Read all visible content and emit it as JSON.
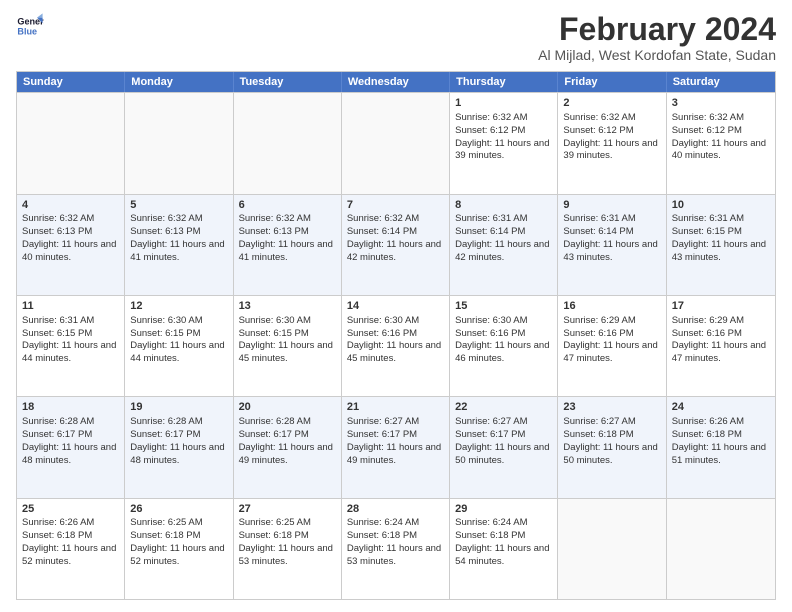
{
  "logo": {
    "line1": "General",
    "line2": "Blue"
  },
  "title": "February 2024",
  "location": "Al Mijlad, West Kordofan State, Sudan",
  "days_of_week": [
    "Sunday",
    "Monday",
    "Tuesday",
    "Wednesday",
    "Thursday",
    "Friday",
    "Saturday"
  ],
  "weeks": [
    [
      {
        "day": "",
        "sunrise": "",
        "sunset": "",
        "daylight": ""
      },
      {
        "day": "",
        "sunrise": "",
        "sunset": "",
        "daylight": ""
      },
      {
        "day": "",
        "sunrise": "",
        "sunset": "",
        "daylight": ""
      },
      {
        "day": "",
        "sunrise": "",
        "sunset": "",
        "daylight": ""
      },
      {
        "day": "1",
        "sunrise": "Sunrise: 6:32 AM",
        "sunset": "Sunset: 6:12 PM",
        "daylight": "Daylight: 11 hours and 39 minutes."
      },
      {
        "day": "2",
        "sunrise": "Sunrise: 6:32 AM",
        "sunset": "Sunset: 6:12 PM",
        "daylight": "Daylight: 11 hours and 39 minutes."
      },
      {
        "day": "3",
        "sunrise": "Sunrise: 6:32 AM",
        "sunset": "Sunset: 6:12 PM",
        "daylight": "Daylight: 11 hours and 40 minutes."
      }
    ],
    [
      {
        "day": "4",
        "sunrise": "Sunrise: 6:32 AM",
        "sunset": "Sunset: 6:13 PM",
        "daylight": "Daylight: 11 hours and 40 minutes."
      },
      {
        "day": "5",
        "sunrise": "Sunrise: 6:32 AM",
        "sunset": "Sunset: 6:13 PM",
        "daylight": "Daylight: 11 hours and 41 minutes."
      },
      {
        "day": "6",
        "sunrise": "Sunrise: 6:32 AM",
        "sunset": "Sunset: 6:13 PM",
        "daylight": "Daylight: 11 hours and 41 minutes."
      },
      {
        "day": "7",
        "sunrise": "Sunrise: 6:32 AM",
        "sunset": "Sunset: 6:14 PM",
        "daylight": "Daylight: 11 hours and 42 minutes."
      },
      {
        "day": "8",
        "sunrise": "Sunrise: 6:31 AM",
        "sunset": "Sunset: 6:14 PM",
        "daylight": "Daylight: 11 hours and 42 minutes."
      },
      {
        "day": "9",
        "sunrise": "Sunrise: 6:31 AM",
        "sunset": "Sunset: 6:14 PM",
        "daylight": "Daylight: 11 hours and 43 minutes."
      },
      {
        "day": "10",
        "sunrise": "Sunrise: 6:31 AM",
        "sunset": "Sunset: 6:15 PM",
        "daylight": "Daylight: 11 hours and 43 minutes."
      }
    ],
    [
      {
        "day": "11",
        "sunrise": "Sunrise: 6:31 AM",
        "sunset": "Sunset: 6:15 PM",
        "daylight": "Daylight: 11 hours and 44 minutes."
      },
      {
        "day": "12",
        "sunrise": "Sunrise: 6:30 AM",
        "sunset": "Sunset: 6:15 PM",
        "daylight": "Daylight: 11 hours and 44 minutes."
      },
      {
        "day": "13",
        "sunrise": "Sunrise: 6:30 AM",
        "sunset": "Sunset: 6:15 PM",
        "daylight": "Daylight: 11 hours and 45 minutes."
      },
      {
        "day": "14",
        "sunrise": "Sunrise: 6:30 AM",
        "sunset": "Sunset: 6:16 PM",
        "daylight": "Daylight: 11 hours and 45 minutes."
      },
      {
        "day": "15",
        "sunrise": "Sunrise: 6:30 AM",
        "sunset": "Sunset: 6:16 PM",
        "daylight": "Daylight: 11 hours and 46 minutes."
      },
      {
        "day": "16",
        "sunrise": "Sunrise: 6:29 AM",
        "sunset": "Sunset: 6:16 PM",
        "daylight": "Daylight: 11 hours and 47 minutes."
      },
      {
        "day": "17",
        "sunrise": "Sunrise: 6:29 AM",
        "sunset": "Sunset: 6:16 PM",
        "daylight": "Daylight: 11 hours and 47 minutes."
      }
    ],
    [
      {
        "day": "18",
        "sunrise": "Sunrise: 6:28 AM",
        "sunset": "Sunset: 6:17 PM",
        "daylight": "Daylight: 11 hours and 48 minutes."
      },
      {
        "day": "19",
        "sunrise": "Sunrise: 6:28 AM",
        "sunset": "Sunset: 6:17 PM",
        "daylight": "Daylight: 11 hours and 48 minutes."
      },
      {
        "day": "20",
        "sunrise": "Sunrise: 6:28 AM",
        "sunset": "Sunset: 6:17 PM",
        "daylight": "Daylight: 11 hours and 49 minutes."
      },
      {
        "day": "21",
        "sunrise": "Sunrise: 6:27 AM",
        "sunset": "Sunset: 6:17 PM",
        "daylight": "Daylight: 11 hours and 49 minutes."
      },
      {
        "day": "22",
        "sunrise": "Sunrise: 6:27 AM",
        "sunset": "Sunset: 6:17 PM",
        "daylight": "Daylight: 11 hours and 50 minutes."
      },
      {
        "day": "23",
        "sunrise": "Sunrise: 6:27 AM",
        "sunset": "Sunset: 6:18 PM",
        "daylight": "Daylight: 11 hours and 50 minutes."
      },
      {
        "day": "24",
        "sunrise": "Sunrise: 6:26 AM",
        "sunset": "Sunset: 6:18 PM",
        "daylight": "Daylight: 11 hours and 51 minutes."
      }
    ],
    [
      {
        "day": "25",
        "sunrise": "Sunrise: 6:26 AM",
        "sunset": "Sunset: 6:18 PM",
        "daylight": "Daylight: 11 hours and 52 minutes."
      },
      {
        "day": "26",
        "sunrise": "Sunrise: 6:25 AM",
        "sunset": "Sunset: 6:18 PM",
        "daylight": "Daylight: 11 hours and 52 minutes."
      },
      {
        "day": "27",
        "sunrise": "Sunrise: 6:25 AM",
        "sunset": "Sunset: 6:18 PM",
        "daylight": "Daylight: 11 hours and 53 minutes."
      },
      {
        "day": "28",
        "sunrise": "Sunrise: 6:24 AM",
        "sunset": "Sunset: 6:18 PM",
        "daylight": "Daylight: 11 hours and 53 minutes."
      },
      {
        "day": "29",
        "sunrise": "Sunrise: 6:24 AM",
        "sunset": "Sunset: 6:18 PM",
        "daylight": "Daylight: 11 hours and 54 minutes."
      },
      {
        "day": "",
        "sunrise": "",
        "sunset": "",
        "daylight": ""
      },
      {
        "day": "",
        "sunrise": "",
        "sunset": "",
        "daylight": ""
      }
    ]
  ]
}
